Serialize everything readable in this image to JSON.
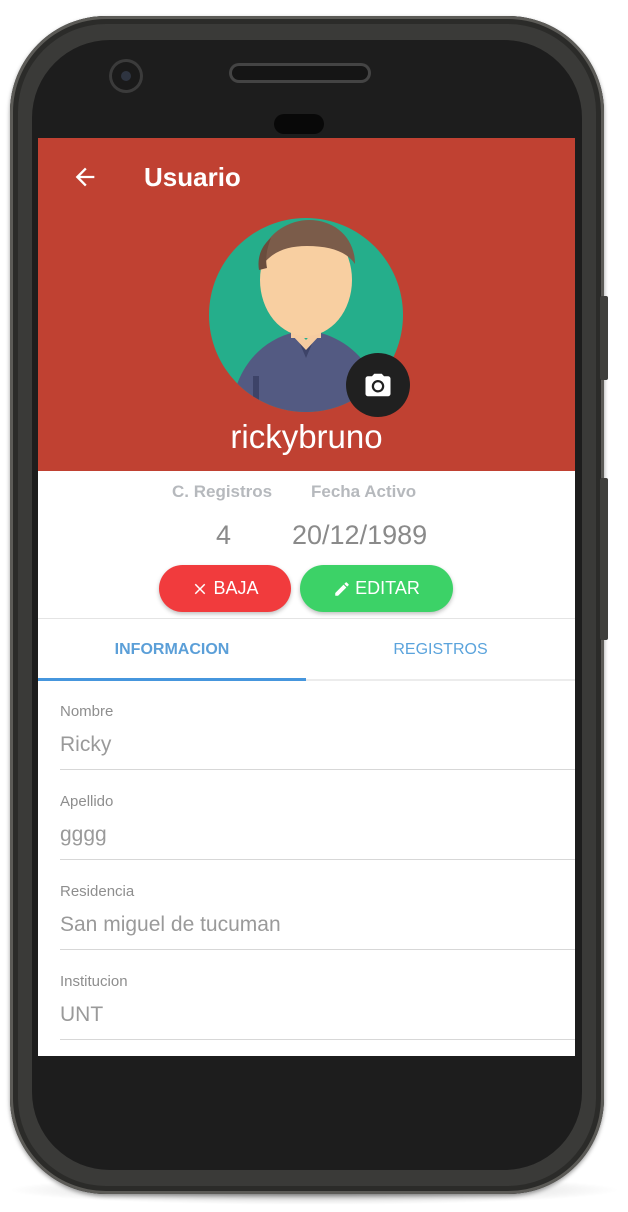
{
  "header": {
    "title": "Usuario",
    "username": "ricky­bruno",
    "back_icon": "arrow-back-icon",
    "camera_icon": "camera-icon"
  },
  "stats": {
    "registros_label": "C. Registros",
    "registros_value": "4",
    "fecha_label": "Fecha Activo",
    "fecha_value": "20/12/1989"
  },
  "actions": {
    "baja_label": "BAJA",
    "editar_label": "EDITAR",
    "baja_icon": "close-icon",
    "editar_icon": "pencil-icon"
  },
  "tabs": [
    {
      "label": "INFORMACION",
      "active": true
    },
    {
      "label": "REGISTROS",
      "active": false
    }
  ],
  "fields": [
    {
      "label": "Nombre",
      "value": "Ricky"
    },
    {
      "label": "Apellido",
      "value": "gggg"
    },
    {
      "label": "Residencia",
      "value": "San miguel de tucuman"
    },
    {
      "label": "Institucion",
      "value": "UNT"
    }
  ],
  "colors": {
    "header_bg": "#c04132",
    "avatar_bg": "#25ae8b",
    "baja": "#f13b3d",
    "editar": "#3cd267",
    "tab_accent": "#4696dd"
  }
}
